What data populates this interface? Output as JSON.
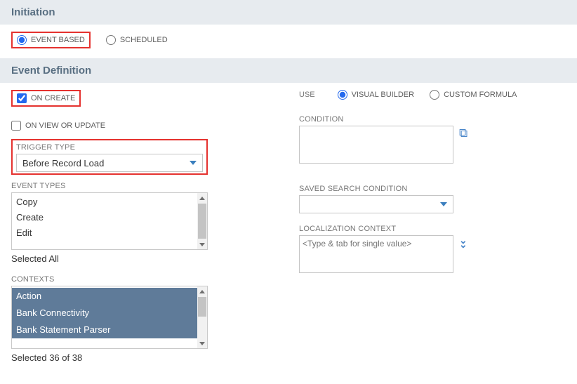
{
  "sections": {
    "initiation": "Initiation",
    "event_definition": "Event Definition"
  },
  "initiation": {
    "event_based": "EVENT BASED",
    "scheduled": "SCHEDULED"
  },
  "event_def": {
    "on_create": "ON CREATE",
    "on_view_or_update": "ON VIEW OR UPDATE",
    "trigger_type_label": "TRIGGER TYPE",
    "trigger_type_value": "Before Record Load",
    "event_types_label": "EVENT TYPES",
    "event_types": [
      "Copy",
      "Create",
      "Edit"
    ],
    "event_types_helper": "Selected All",
    "contexts_label": "CONTEXTS",
    "contexts": [
      "Action",
      "Bank Connectivity",
      "Bank Statement Parser"
    ],
    "contexts_helper": "Selected 36 of 38"
  },
  "right": {
    "use_label": "USE",
    "visual_builder": "VISUAL BUILDER",
    "custom_formula": "CUSTOM FORMULA",
    "condition_label": "CONDITION",
    "saved_search_label": "SAVED SEARCH CONDITION",
    "localization_label": "LOCALIZATION CONTEXT",
    "localization_placeholder": "<Type & tab for single value>"
  }
}
